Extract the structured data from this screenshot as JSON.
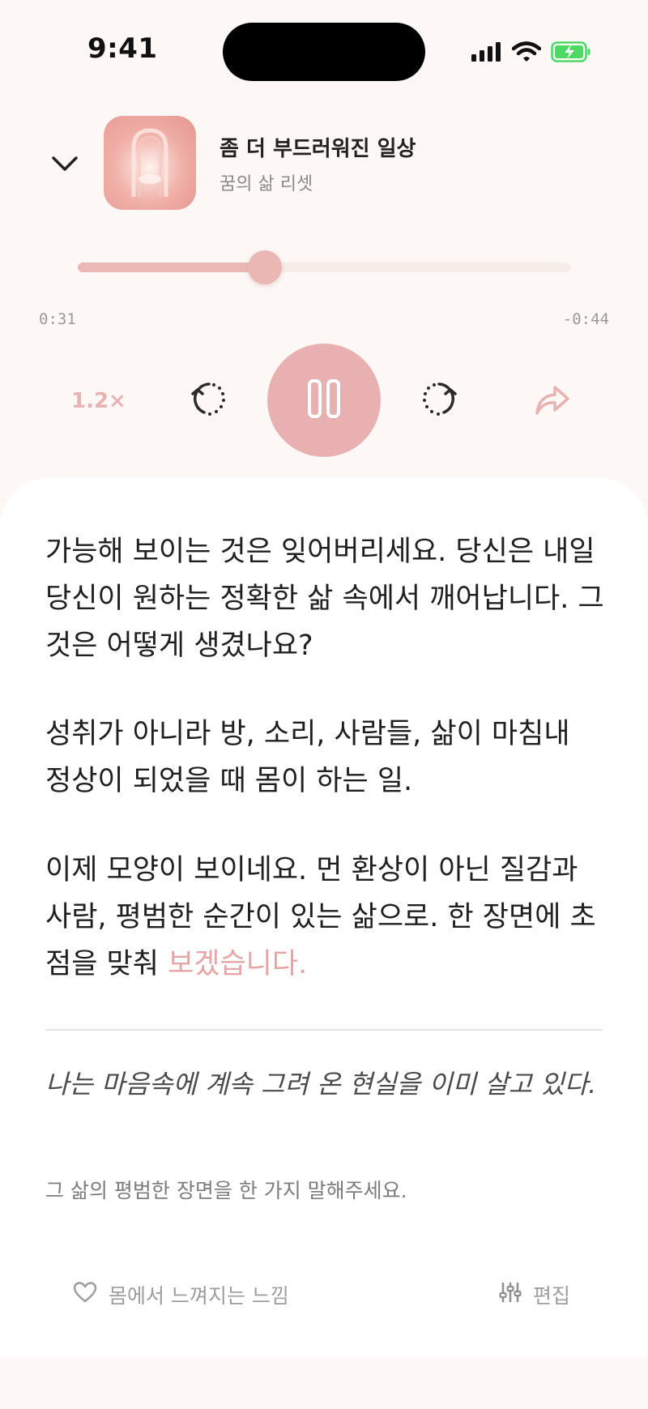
{
  "status_bar": {
    "time": "9:41"
  },
  "player": {
    "track_title": "좀 더 부드러워진 일상",
    "track_subtitle": "꿈의 삶 리셋",
    "progress_fraction": 0.38,
    "elapsed": "0:31",
    "remaining": "-0:44",
    "speed_label": "1.2×",
    "accent_color": "#e8b0b0"
  },
  "content": {
    "paragraph1": "가능해 보이는 것은 잊어버리세요. 당신은 내일 당신이 원하는 정확한 삶 속에서 깨어납니다. 그것은 어떻게 생겼나요?",
    "paragraph2": "성취가 아니라 방, 소리, 사람들, 삶이 마침내 정상이 되었을 때 몸이 하는 일.",
    "paragraph3_main": "이제 모양이 보이네요. 먼 환상이 아닌 질감과 사람, 평범한 순간이 있는 삶으로. 한 장면에 초점을 맞춰 ",
    "paragraph3_highlight": "보겠습니다.",
    "affirmation": "나는 마음속에 계속 그려 온 현실을 이미 살고 있다.",
    "prompt": "그 삶의 평범한 장면을 한 가지 말해주세요."
  },
  "footer": {
    "feel_label": "몸에서 느껴지는 느낌",
    "edit_label": "편집"
  }
}
